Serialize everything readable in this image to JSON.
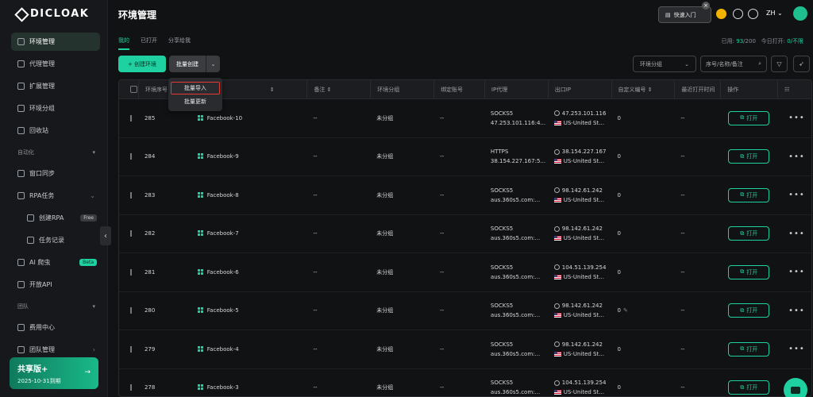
{
  "brand": {
    "name": "DICLOAK"
  },
  "sidebar": {
    "items": [
      {
        "label": "环境管理",
        "icon": "globe-icon",
        "active": true
      },
      {
        "label": "代理管理",
        "icon": "proxy-icon"
      },
      {
        "label": "扩展管理",
        "icon": "puzzle-icon"
      },
      {
        "label": "环境分组",
        "icon": "folder-icon"
      },
      {
        "label": "回收站",
        "icon": "trash-icon"
      }
    ],
    "automation_section": "自动化",
    "automation_items": [
      {
        "label": "窗口同步",
        "icon": "sync-icon"
      },
      {
        "label": "RPA任务",
        "icon": "robot-icon"
      }
    ],
    "rpa_sub": [
      {
        "label": "创建RPA",
        "tag": "Free"
      },
      {
        "label": "任务记录"
      }
    ],
    "other_items": [
      {
        "label": "AI 爬虫",
        "tag": "Beta"
      },
      {
        "label": "开放API"
      }
    ],
    "team_section": "团队",
    "team_items": [
      {
        "label": "费用中心"
      },
      {
        "label": "团队管理"
      }
    ],
    "plan": {
      "title": "共享版+",
      "expiry": "2025-10-31到期"
    }
  },
  "header": {
    "title": "环境管理",
    "quick_start": "快速入门",
    "lang": "ZH"
  },
  "tabs": [
    "我的",
    "已打开",
    "分享给我"
  ],
  "usage": {
    "used_label": "已用: ",
    "used": "93",
    "total": "/200",
    "today_label": "今日打开: ",
    "today": "0/不限"
  },
  "toolbar": {
    "create": "+ 创建环境",
    "batch_create": "批量创建",
    "group_placeholder": "环境分组",
    "search_placeholder": "序号/名称/备注"
  },
  "dropdown": [
    "批量导入",
    "批量更新"
  ],
  "table": {
    "headers": [
      "环境序号",
      "",
      "备注",
      "环境分组",
      "绑定账号",
      "IP代理",
      "出口IP",
      "自定义编号",
      "最近打开时间",
      "操作"
    ],
    "open_label": "打开",
    "rows": [
      {
        "id": "285",
        "name": "Facebook-10",
        "note": "--",
        "group": "未分组",
        "account": "--",
        "proxy_type": "SOCKS5",
        "proxy_host": "47.253.101.116:4...",
        "ip": "47.253.101.116",
        "country": "US-United St...",
        "custom": "0",
        "last": "--"
      },
      {
        "id": "284",
        "name": "Facebook-9",
        "note": "--",
        "group": "未分组",
        "account": "--",
        "proxy_type": "HTTPS",
        "proxy_host": "38.154.227.167:5...",
        "ip": "38.154.227.167",
        "country": "US-United St...",
        "custom": "0",
        "last": "--"
      },
      {
        "id": "283",
        "name": "Facebook-8",
        "note": "--",
        "group": "未分组",
        "account": "--",
        "proxy_type": "SOCKS5",
        "proxy_host": "aus.360s5.com:...",
        "ip": "98.142.61.242",
        "country": "US-United St...",
        "custom": "0",
        "last": "--"
      },
      {
        "id": "282",
        "name": "Facebook-7",
        "note": "--",
        "group": "未分组",
        "account": "--",
        "proxy_type": "SOCKS5",
        "proxy_host": "aus.360s5.com:...",
        "ip": "98.142.61.242",
        "country": "US-United St...",
        "custom": "0",
        "last": "--"
      },
      {
        "id": "281",
        "name": "Facebook-6",
        "note": "--",
        "group": "未分组",
        "account": "--",
        "proxy_type": "SOCKS5",
        "proxy_host": "aus.360s5.com:...",
        "ip": "104.51.139.254",
        "country": "US-United St...",
        "custom": "0",
        "last": "--"
      },
      {
        "id": "280",
        "name": "Facebook-5",
        "note": "--",
        "group": "未分组",
        "account": "--",
        "proxy_type": "SOCKS5",
        "proxy_host": "aus.360s5.com:...",
        "ip": "98.142.61.242",
        "country": "US-United St...",
        "custom": "0",
        "last": "--"
      },
      {
        "id": "279",
        "name": "Facebook-4",
        "note": "--",
        "group": "未分组",
        "account": "--",
        "proxy_type": "SOCKS5",
        "proxy_host": "aus.360s5.com:...",
        "ip": "98.142.61.242",
        "country": "US-United St...",
        "custom": "0",
        "last": "--"
      },
      {
        "id": "278",
        "name": "Facebook-3",
        "note": "--",
        "group": "未分组",
        "account": "--",
        "proxy_type": "SOCKS5",
        "proxy_host": "aus.360s5.com:...",
        "ip": "104.51.139.254",
        "country": "US-United St...",
        "custom": "0",
        "last": "--"
      }
    ]
  }
}
